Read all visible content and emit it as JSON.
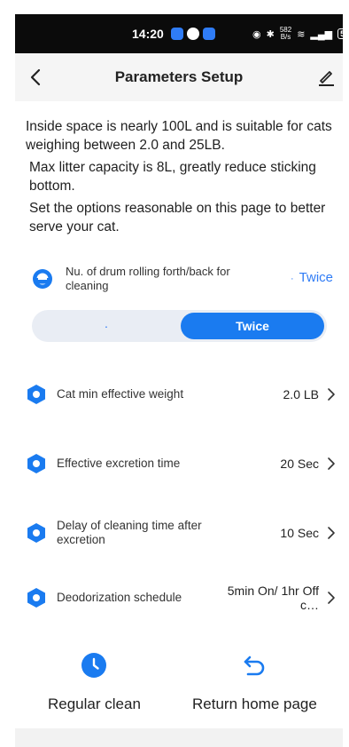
{
  "status_bar": {
    "time": "14:20",
    "net_speed_value": "582",
    "net_speed_unit": "B/s",
    "battery": "57"
  },
  "header": {
    "title": "Parameters Setup"
  },
  "intro": {
    "line1": "Inside space is nearly 100L and is suitable for cats weighing between 2.0  and 25LB.",
    "line2": "Max litter capacity is 8L, greatly reduce sticking bottom.",
    "line3": "Set the options reasonable on this page to better serve your cat."
  },
  "drum": {
    "label": "Nu. of drum rolling forth/back for cleaning",
    "value": "Twice",
    "options": [
      "·",
      "Twice"
    ],
    "selected": "Twice"
  },
  "params": [
    {
      "label": "Cat min effective weight",
      "value": "2.0 LB"
    },
    {
      "label": "Effective excretion time",
      "value": "20 Sec"
    },
    {
      "label": "Delay of cleaning time after excretion",
      "value": "10 Sec"
    },
    {
      "label": "Deodorization schedule",
      "value": "5min On/ 1hr Off c…"
    }
  ],
  "bottom": {
    "regular_clean": "Regular clean",
    "return_home": "Return home page"
  },
  "colors": {
    "accent": "#1a7bf0",
    "header_bg": "#f5f5f5",
    "segment_bg": "#e9edf4"
  }
}
